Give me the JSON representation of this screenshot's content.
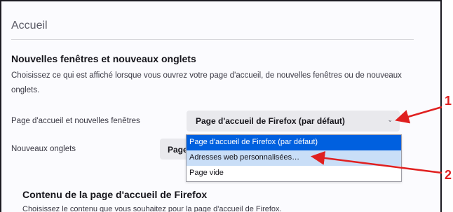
{
  "page": {
    "section_title": "Accueil",
    "heading": "Nouvelles fenêtres et nouveaux onglets",
    "description": "Choisissez ce qui est affiché lorsque vous ouvrez votre page d'accueil, de nouvelles fenêtres ou de nouveaux onglets."
  },
  "home_setting": {
    "label": "Page d'accueil et nouvelles fenêtres",
    "selected": "Page d'accueil de Firefox (par défaut)",
    "options": [
      "Page d'accueil de Firefox (par défaut)",
      "Adresses web personnalisées…",
      "Page vide"
    ]
  },
  "newtab_setting": {
    "label": "Nouveaux onglets",
    "selected_partial": "Page"
  },
  "firefox_home": {
    "heading": "Contenu de la page d'accueil de Firefox",
    "description": "Choisissez le contenu que vous souhaitez pour la page d'accueil de Firefox."
  },
  "annotations": {
    "callout_1": "1",
    "callout_2": "2",
    "color": "#e02020"
  },
  "icons": {
    "dropdown_chevron": "chevron-down-icon"
  },
  "colors": {
    "accent": "#0060df",
    "hover_option": "#c9def7",
    "button_bg": "#e9e9ed"
  }
}
